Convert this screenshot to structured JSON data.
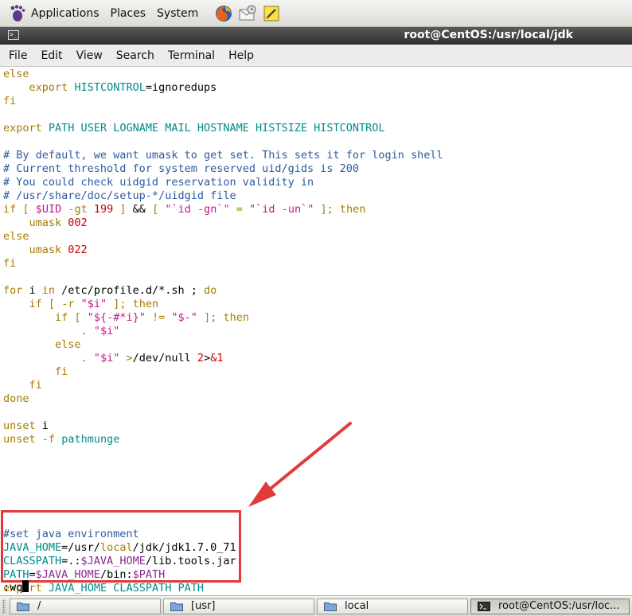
{
  "top_panel": {
    "menus": [
      "Applications",
      "Places",
      "System"
    ],
    "launchers": [
      "firefox-icon",
      "mail-icon",
      "notes-icon"
    ]
  },
  "window": {
    "title": "root@CentOS:/usr/local/jdk",
    "menu": [
      "File",
      "Edit",
      "View",
      "Search",
      "Terminal",
      "Help"
    ]
  },
  "terminal": {
    "lines": [
      [
        {
          "t": "else",
          "c": "kw"
        }
      ],
      [
        {
          "t": "    "
        },
        {
          "t": "export",
          "c": "kw"
        },
        {
          "t": " "
        },
        {
          "t": "HISTCONTROL",
          "c": "var"
        },
        {
          "t": "=ignoredups"
        }
      ],
      [
        {
          "t": "fi",
          "c": "kw"
        }
      ],
      [],
      [
        {
          "t": "export",
          "c": "kw"
        },
        {
          "t": " "
        },
        {
          "t": "PATH USER LOGNAME MAIL HOSTNAME HISTSIZE HISTCONTROL",
          "c": "var"
        }
      ],
      [],
      [
        {
          "t": "# By default, we want umask to get set. This sets it for login shell",
          "c": "cmt"
        }
      ],
      [
        {
          "t": "# Current threshold for system reserved uid/gids is 200",
          "c": "cmt"
        }
      ],
      [
        {
          "t": "# You could check uidgid reservation validity in",
          "c": "cmt"
        }
      ],
      [
        {
          "t": "# /usr/share/doc/setup-*/uidgid file",
          "c": "cmt"
        }
      ],
      [
        {
          "t": "if",
          "c": "kw"
        },
        {
          "t": " "
        },
        {
          "t": "[",
          "c": "kw"
        },
        {
          "t": " "
        },
        {
          "t": "$UID",
          "c": "str"
        },
        {
          "t": " "
        },
        {
          "t": "-gt",
          "c": "kw"
        },
        {
          "t": " "
        },
        {
          "t": "199",
          "c": "num"
        },
        {
          "t": " "
        },
        {
          "t": "]",
          "c": "kw"
        },
        {
          "t": " && "
        },
        {
          "t": "[",
          "c": "kw"
        },
        {
          "t": " "
        },
        {
          "t": "\"`id -gn`\"",
          "c": "str"
        },
        {
          "t": " "
        },
        {
          "t": "=",
          "c": "kw"
        },
        {
          "t": " "
        },
        {
          "t": "\"`id -un`\"",
          "c": "str"
        },
        {
          "t": " "
        },
        {
          "t": "];",
          "c": "kw"
        },
        {
          "t": " "
        },
        {
          "t": "then",
          "c": "kw"
        }
      ],
      [
        {
          "t": "    "
        },
        {
          "t": "umask",
          "c": "kw"
        },
        {
          "t": " "
        },
        {
          "t": "002",
          "c": "num"
        }
      ],
      [
        {
          "t": "else",
          "c": "kw"
        }
      ],
      [
        {
          "t": "    "
        },
        {
          "t": "umask",
          "c": "kw"
        },
        {
          "t": " "
        },
        {
          "t": "022",
          "c": "num"
        }
      ],
      [
        {
          "t": "fi",
          "c": "kw"
        }
      ],
      [],
      [
        {
          "t": "for",
          "c": "kw"
        },
        {
          "t": " i "
        },
        {
          "t": "in",
          "c": "kw"
        },
        {
          "t": " /etc/profile.d/*.sh ; "
        },
        {
          "t": "do",
          "c": "kw"
        }
      ],
      [
        {
          "t": "    "
        },
        {
          "t": "if",
          "c": "kw"
        },
        {
          "t": " "
        },
        {
          "t": "[",
          "c": "kw"
        },
        {
          "t": " "
        },
        {
          "t": "-r",
          "c": "kw"
        },
        {
          "t": " "
        },
        {
          "t": "\"$i\"",
          "c": "str"
        },
        {
          "t": " "
        },
        {
          "t": "];",
          "c": "kw"
        },
        {
          "t": " "
        },
        {
          "t": "then",
          "c": "kw"
        }
      ],
      [
        {
          "t": "        "
        },
        {
          "t": "if",
          "c": "kw"
        },
        {
          "t": " "
        },
        {
          "t": "[",
          "c": "kw"
        },
        {
          "t": " "
        },
        {
          "t": "\"${-#*i}\"",
          "c": "str"
        },
        {
          "t": " "
        },
        {
          "t": "!=",
          "c": "kw"
        },
        {
          "t": " "
        },
        {
          "t": "\"$-\"",
          "c": "str"
        },
        {
          "t": " "
        },
        {
          "t": "];",
          "c": "kw"
        },
        {
          "t": " "
        },
        {
          "t": "then",
          "c": "kw"
        }
      ],
      [
        {
          "t": "            "
        },
        {
          "t": ".",
          "c": "kw"
        },
        {
          "t": " "
        },
        {
          "t": "\"$i\"",
          "c": "str"
        }
      ],
      [
        {
          "t": "        "
        },
        {
          "t": "else",
          "c": "kw"
        }
      ],
      [
        {
          "t": "            "
        },
        {
          "t": ".",
          "c": "kw"
        },
        {
          "t": " "
        },
        {
          "t": "\"$i\"",
          "c": "str"
        },
        {
          "t": " "
        },
        {
          "t": ">",
          "c": "kw"
        },
        {
          "t": "/dev/null "
        },
        {
          "t": "2",
          "c": "num"
        },
        {
          "t": ">"
        },
        {
          "t": "&1",
          "c": "num"
        }
      ],
      [
        {
          "t": "        "
        },
        {
          "t": "fi",
          "c": "kw"
        }
      ],
      [
        {
          "t": "    "
        },
        {
          "t": "fi",
          "c": "kw"
        }
      ],
      [
        {
          "t": "done",
          "c": "kw"
        }
      ],
      [],
      [
        {
          "t": "unset",
          "c": "kw"
        },
        {
          "t": " i"
        }
      ],
      [
        {
          "t": "unset",
          "c": "kw"
        },
        {
          "t": " "
        },
        {
          "t": "-f",
          "c": "kw"
        },
        {
          "t": " "
        },
        {
          "t": "pathmunge",
          "c": "var"
        }
      ],
      [],
      [],
      [],
      [],
      [],
      [],
      [
        {
          "t": "#set java environment",
          "c": "cmt"
        }
      ],
      [
        {
          "t": "JAVA_HOME",
          "c": "var"
        },
        {
          "t": "=/usr/"
        },
        {
          "t": "local",
          "c": "kw"
        },
        {
          "t": "/jdk/jdk1.7.0_71"
        }
      ],
      [
        {
          "t": "CLASSPATH",
          "c": "var"
        },
        {
          "t": "=.:"
        },
        {
          "t": "$JAVA_HOME",
          "c": "cmd"
        },
        {
          "t": "/lib.tools.jar"
        }
      ],
      [
        {
          "t": "PATH",
          "c": "var"
        },
        {
          "t": "="
        },
        {
          "t": "$JAVA_HOME",
          "c": "cmd"
        },
        {
          "t": "/bin:"
        },
        {
          "t": "$PATH",
          "c": "cmd"
        }
      ],
      [
        {
          "t": "export",
          "c": "kw"
        },
        {
          "t": " "
        },
        {
          "t": "JAVA_HOME CLASSPATH PATH",
          "c": "var"
        }
      ]
    ],
    "command_line": ":wq"
  },
  "annotation": {
    "color": "#e03a3a"
  },
  "taskbar": {
    "items": [
      {
        "label": "/",
        "icon": "folder-icon"
      },
      {
        "label": "[usr]",
        "icon": "folder-icon"
      },
      {
        "label": "local",
        "icon": "folder-icon"
      },
      {
        "label": "root@CentOS:/usr/loc...",
        "icon": "terminal-icon"
      }
    ]
  }
}
